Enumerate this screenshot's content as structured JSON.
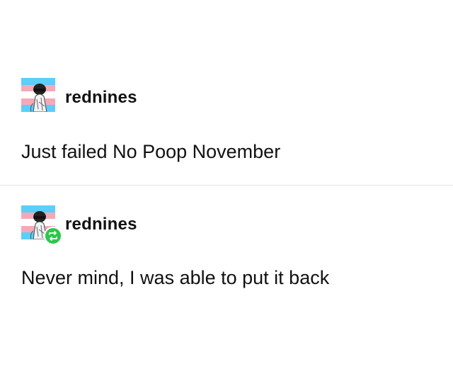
{
  "posts": [
    {
      "username": "rednines",
      "text": "Just failed No Poop November",
      "avatar_icon": "trans-flag-avatar-icon",
      "is_reblog": false
    },
    {
      "username": "rednines",
      "text": "Never mind, I was able to put it back",
      "avatar_icon": "trans-flag-avatar-icon",
      "is_reblog": true,
      "badge_icon": "reblog-icon"
    }
  ],
  "colors": {
    "trans_blue": "#5bcefa",
    "trans_pink": "#f5a9b8",
    "white": "#ffffff",
    "reblog_green": "#2bc84a",
    "divider": "#e3e3e3"
  }
}
